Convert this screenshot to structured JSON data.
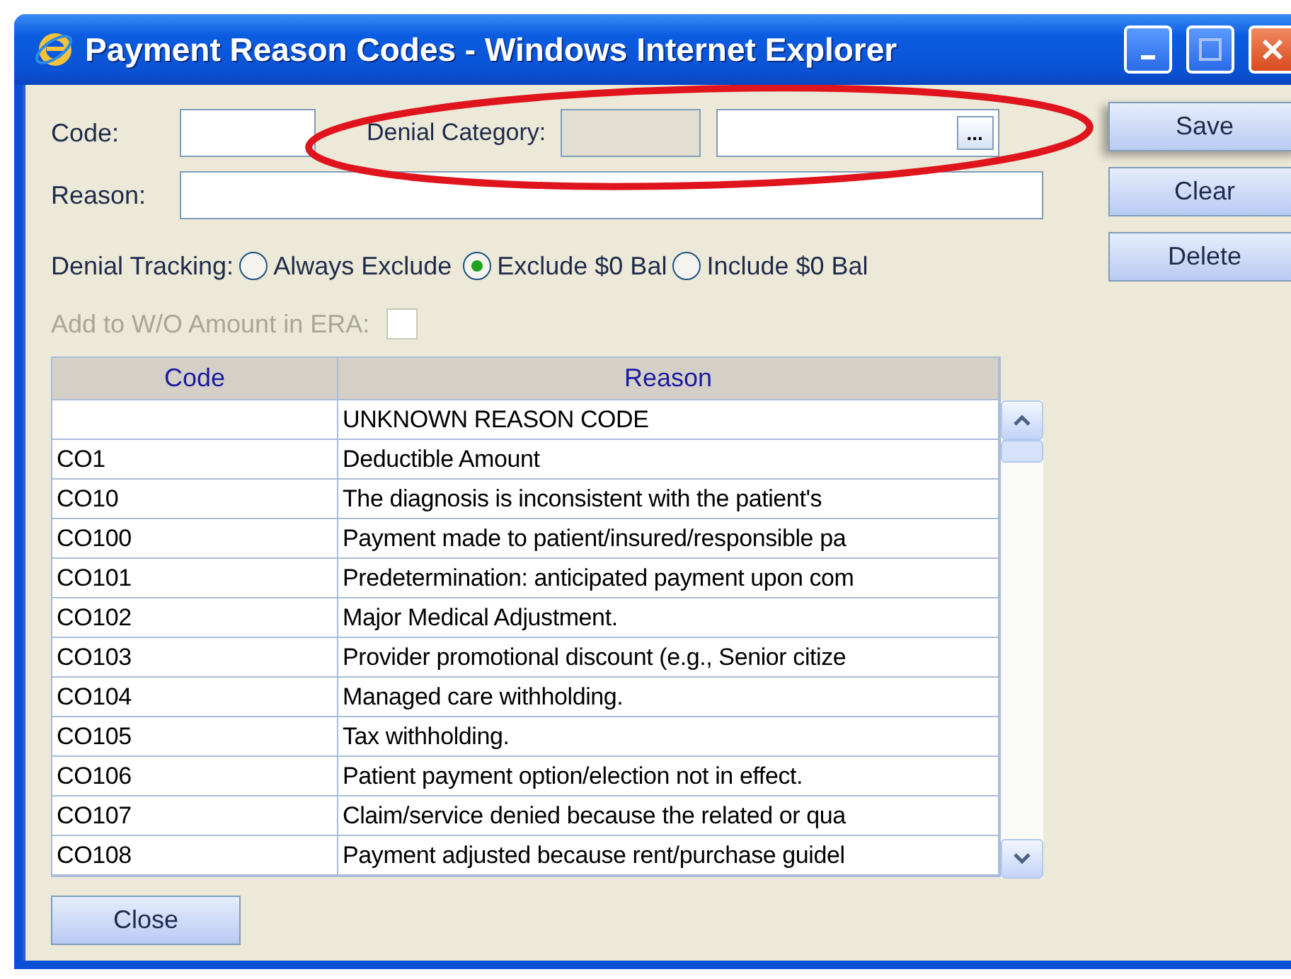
{
  "window": {
    "title": "Payment Reason Codes - Windows Internet Explorer"
  },
  "form": {
    "code": {
      "label": "Code:"
    },
    "denial_category": {
      "label": "Denial Category:",
      "code_field": {
        "disabled": true
      },
      "name_field": {
        "disabled": false
      },
      "browse_button": {
        "label": "..."
      }
    },
    "reason": {
      "label": "Reason:"
    },
    "denial_tracking": {
      "label": "Denial Tracking:",
      "options": [
        {
          "label": "Always Exclude",
          "selected": false
        },
        {
          "label": "Exclude $0 Bal",
          "selected": true
        },
        {
          "label": "Include $0 Bal",
          "selected": false
        }
      ]
    },
    "add_wo": {
      "label": "Add to W/O Amount in ERA:",
      "disabled": true,
      "checked": false
    }
  },
  "buttons": [
    {
      "label": "Save"
    },
    {
      "label": "Clear"
    },
    {
      "label": "Delete"
    }
  ],
  "table": {
    "columns": [
      "Code",
      "Reason"
    ],
    "rows": [
      {
        "reason": "UNKNOWN REASON CODE"
      },
      {
        "code": "CO1",
        "reason": "Deductible Amount"
      },
      {
        "code": "CO10",
        "reason": "The diagnosis is inconsistent with the patient's"
      },
      {
        "code": "CO100",
        "reason": "Payment made to patient/insured/responsible pa"
      },
      {
        "code": "CO101",
        "reason": "Predetermination: anticipated payment upon com"
      },
      {
        "code": "CO102",
        "reason": "Major Medical Adjustment."
      },
      {
        "code": "CO103",
        "reason": "Provider promotional discount (e.g., Senior citize"
      },
      {
        "code": "CO104",
        "reason": "Managed care withholding."
      },
      {
        "code": "CO105",
        "reason": "Tax withholding."
      },
      {
        "code": "CO106",
        "reason": "Patient payment option/election not in effect."
      },
      {
        "code": "CO107",
        "reason": "Claim/service denied because the related or qua"
      },
      {
        "code": "CO108",
        "reason": "Payment adjusted because rent/purchase guidel"
      }
    ]
  },
  "close_button": {
    "label": "Close"
  },
  "highlight": {
    "kind": "ellipse"
  }
}
